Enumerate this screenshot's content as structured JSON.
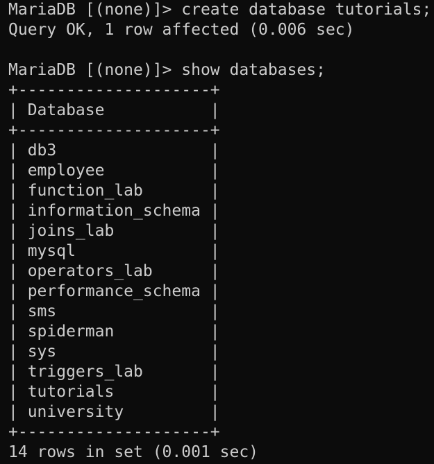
{
  "terminal": {
    "lines": [
      {
        "type": "command",
        "prompt": "MariaDB [(none)]> ",
        "command": "create database tutorials;"
      },
      {
        "type": "output",
        "text": "Query OK, 1 row affected (0.006 sec)"
      },
      {
        "type": "blank",
        "text": ""
      },
      {
        "type": "command",
        "prompt": "MariaDB [(none)]> ",
        "command": "show databases;"
      },
      {
        "type": "border",
        "text": "+--------------------+"
      },
      {
        "type": "header",
        "text": "| Database           |"
      },
      {
        "type": "border",
        "text": "+--------------------+"
      },
      {
        "type": "row",
        "text": "| db3                |"
      },
      {
        "type": "row",
        "text": "| employee           |"
      },
      {
        "type": "row",
        "text": "| function_lab       |"
      },
      {
        "type": "row",
        "text": "| information_schema |"
      },
      {
        "type": "row",
        "text": "| joins_lab          |"
      },
      {
        "type": "row",
        "text": "| mysql              |"
      },
      {
        "type": "row",
        "text": "| operators_lab      |"
      },
      {
        "type": "row",
        "text": "| performance_schema |"
      },
      {
        "type": "row",
        "text": "| sms                |"
      },
      {
        "type": "row",
        "text": "| spiderman          |"
      },
      {
        "type": "row",
        "text": "| sys                |"
      },
      {
        "type": "row",
        "text": "| triggers_lab       |"
      },
      {
        "type": "row",
        "text": "| tutorials          |"
      },
      {
        "type": "row",
        "text": "| university         |"
      },
      {
        "type": "border",
        "text": "+--------------------+"
      },
      {
        "type": "output",
        "text": "14 rows in set (0.001 sec)"
      }
    ]
  }
}
